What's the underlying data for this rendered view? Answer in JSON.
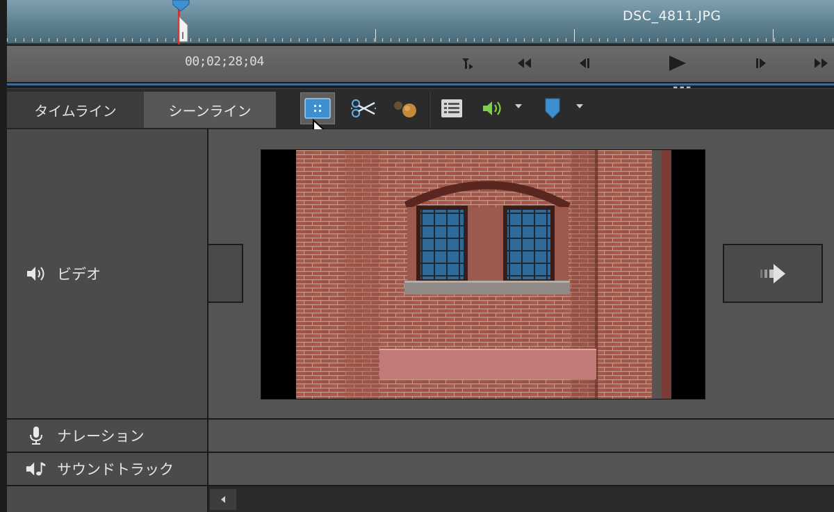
{
  "ruler": {
    "clip_name": "DSC_4811.JPG"
  },
  "transport": {
    "timecode": "00;02;28;04",
    "buttons": [
      "set-in-icon",
      "rewind-icon",
      "step-back-icon",
      "play-icon",
      "step-forward-icon",
      "fast-forward-icon"
    ]
  },
  "toolbar": {
    "tabs": [
      {
        "label": "タイムライン",
        "active": false
      },
      {
        "label": "シーンライン",
        "active": true
      }
    ],
    "tools": [
      "smart-fit-icon",
      "scissors-icon",
      "effects-icon",
      "list-icon",
      "speaker-icon",
      "marker-icon"
    ]
  },
  "tracks": {
    "video": {
      "label": "ビデオ"
    },
    "narration": {
      "label": "ナレーション"
    },
    "soundtrack": {
      "label": "サウンドトラック"
    }
  },
  "colors": {
    "ruler_top": "#7fa0b0",
    "accent_blue": "#3d8fcf",
    "speaker_green": "#7ccf4a",
    "playhead_red": "#c83232"
  }
}
